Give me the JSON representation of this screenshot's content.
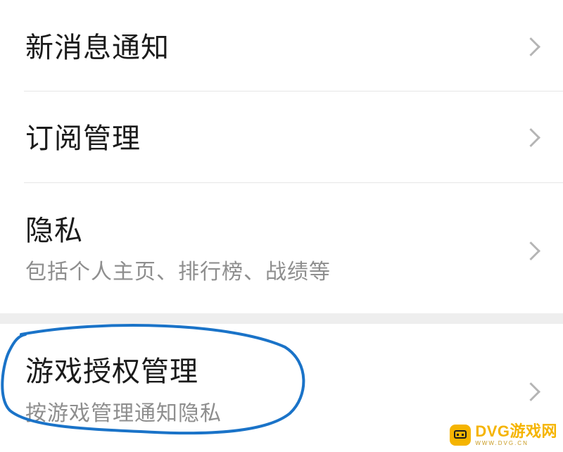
{
  "settings": {
    "items": [
      {
        "title": "新消息通知",
        "subtitle": ""
      },
      {
        "title": "订阅管理",
        "subtitle": ""
      },
      {
        "title": "隐私",
        "subtitle": "包括个人主页、排行榜、战绩等"
      },
      {
        "title": "游戏授权管理",
        "subtitle": "按游戏管理通知隐私"
      }
    ]
  },
  "annotation": {
    "color": "#1a73c8",
    "shape": "hand-drawn ellipse around the game authorization item"
  },
  "watermark": {
    "text": "DVG游戏网",
    "subtext": "WWW.DVG.CN",
    "color": "#f5b400",
    "icon": "gamepad-icon"
  }
}
